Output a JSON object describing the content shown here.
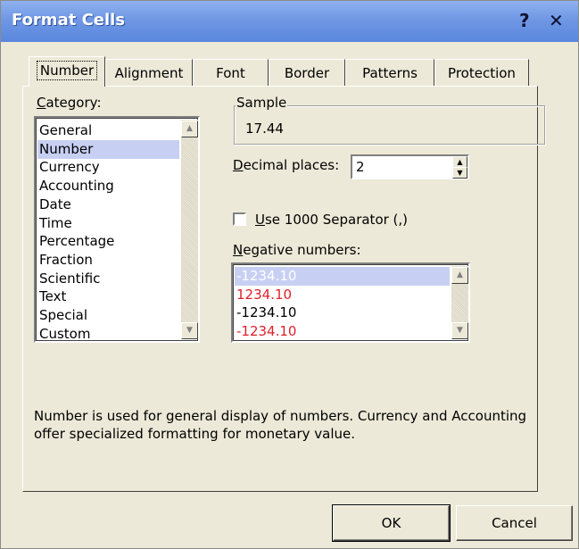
{
  "window": {
    "title": "Format Cells",
    "help_icon": "?",
    "close_icon": "✕"
  },
  "tabs": [
    {
      "label": "Number",
      "active": true
    },
    {
      "label": "Alignment"
    },
    {
      "label": "Font"
    },
    {
      "label": "Border"
    },
    {
      "label": "Patterns"
    },
    {
      "label": "Protection"
    }
  ],
  "category": {
    "label": "Category:",
    "items": [
      "General",
      "Number",
      "Currency",
      "Accounting",
      "Date",
      "Time",
      "Percentage",
      "Fraction",
      "Scientific",
      "Text",
      "Special",
      "Custom"
    ],
    "selected": "Number"
  },
  "sample": {
    "label": "Sample",
    "value": "17.44"
  },
  "decimal": {
    "label": "Decimal places:",
    "value": "2"
  },
  "separator": {
    "label": "Use 1000 Separator (,)",
    "checked": false
  },
  "negative": {
    "label": "Negative numbers:",
    "items": [
      "-1234.10",
      "1234.10",
      "-1234.10",
      "-1234.10"
    ],
    "colors": [
      "#ffffff",
      "#e0202a",
      "#000000",
      "#e0202a"
    ],
    "selected_index": 0
  },
  "description": {
    "line1": "Number is used for general display of numbers.  Currency and Accounting",
    "line2": "offer specialized formatting for monetary value."
  },
  "buttons": {
    "ok": "OK",
    "cancel": "Cancel"
  },
  "colors": {
    "selection": "#c7d0f3",
    "negative_red": "#e0202a",
    "title_bar": "#6f97e4"
  }
}
